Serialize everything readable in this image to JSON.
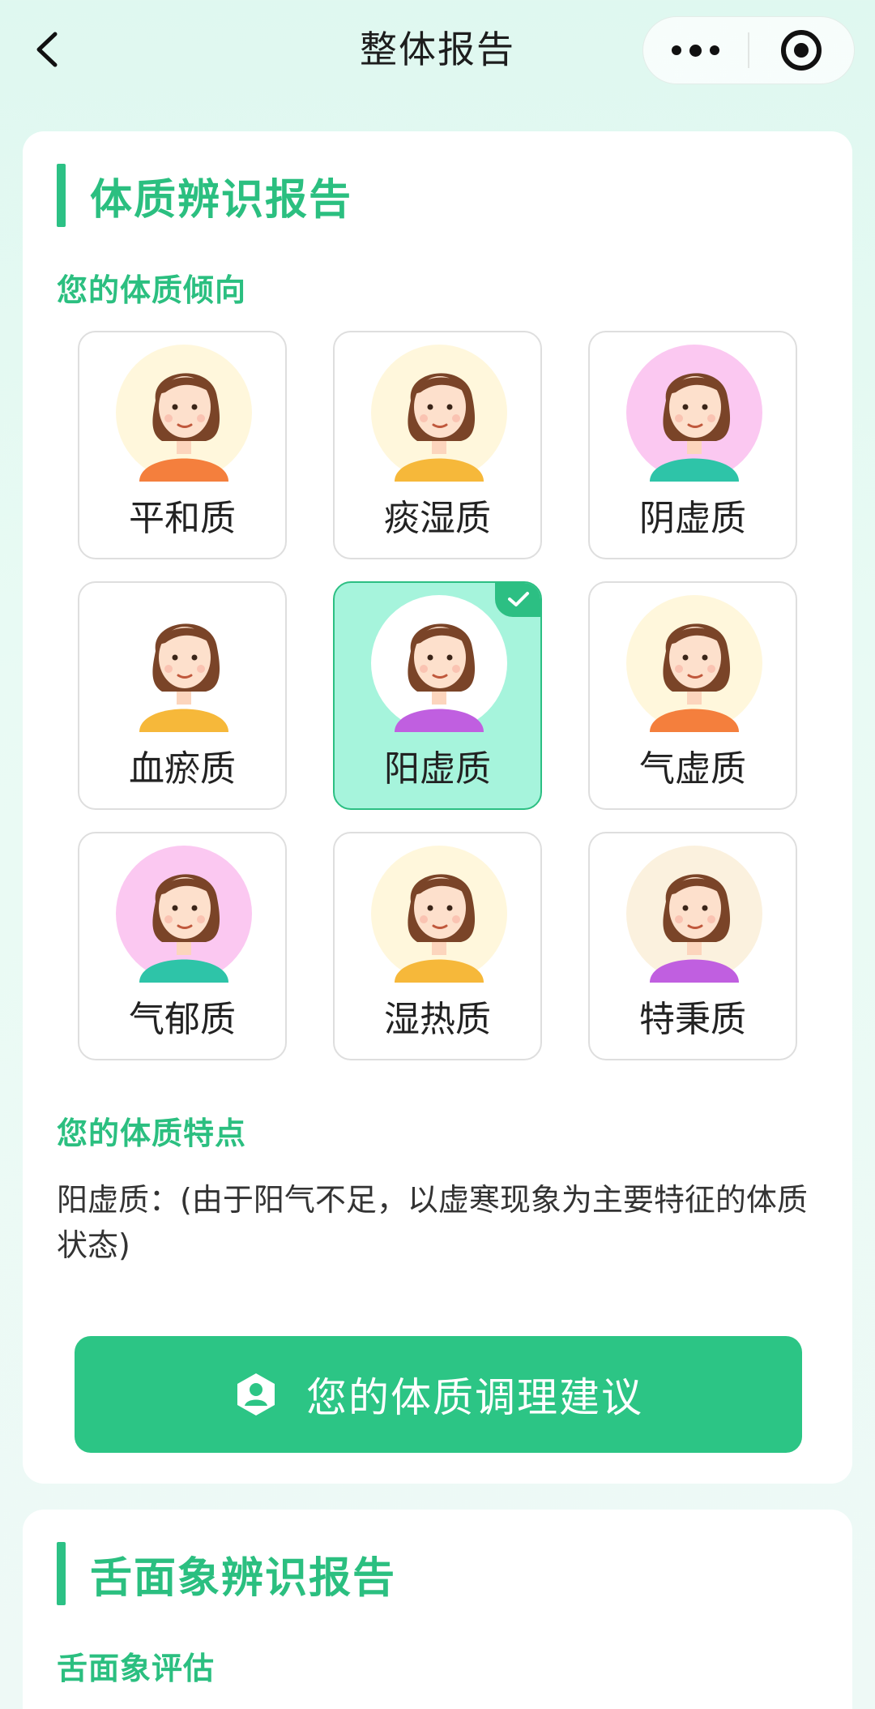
{
  "nav": {
    "title": "整体报告",
    "back_icon": "chevron-left-icon",
    "more_icon": "more-dots-icon",
    "target_icon": "target-icon"
  },
  "constitution_card": {
    "title": "体质辨识报告",
    "tendency_heading": "您的体质倾向",
    "types": [
      {
        "label": "平和质",
        "selected": false,
        "bg": "#fff7dc",
        "shirt": "#f47f3d"
      },
      {
        "label": "痰湿质",
        "selected": false,
        "bg": "#fff7dc",
        "shirt": "#f6b83a"
      },
      {
        "label": "阴虚质",
        "selected": false,
        "bg": "#fbc8f1",
        "shirt": "#2ec4a8"
      },
      {
        "label": "血瘀质",
        "selected": false,
        "bg": "#ffffff",
        "shirt": "#f6b83a"
      },
      {
        "label": "阳虚质",
        "selected": true,
        "bg": "#ffffff",
        "shirt": "#c05fe0"
      },
      {
        "label": "气虚质",
        "selected": false,
        "bg": "#fff7dc",
        "shirt": "#f47f3d"
      },
      {
        "label": "气郁质",
        "selected": false,
        "bg": "#fbc8f1",
        "shirt": "#2ec4a8"
      },
      {
        "label": "湿热质",
        "selected": false,
        "bg": "#fff7dc",
        "shirt": "#f6b83a"
      },
      {
        "label": "特秉质",
        "selected": false,
        "bg": "#fbf1de",
        "shirt": "#c05fe0"
      }
    ],
    "feature_heading": "您的体质特点",
    "feature_text": "阳虚质：(由于阳气不足，以虚寒现象为主要特征的体质状态)",
    "advice_button": "您的体质调理建议",
    "advice_icon": "user-shield-icon"
  },
  "tongue_card": {
    "title": "舌面象辨识报告",
    "evaluation_heading": "舌面象评估"
  },
  "colors": {
    "accent": "#2bbf80",
    "selected_bg": "#a6f4dc",
    "button_bg": "#2cc585"
  }
}
